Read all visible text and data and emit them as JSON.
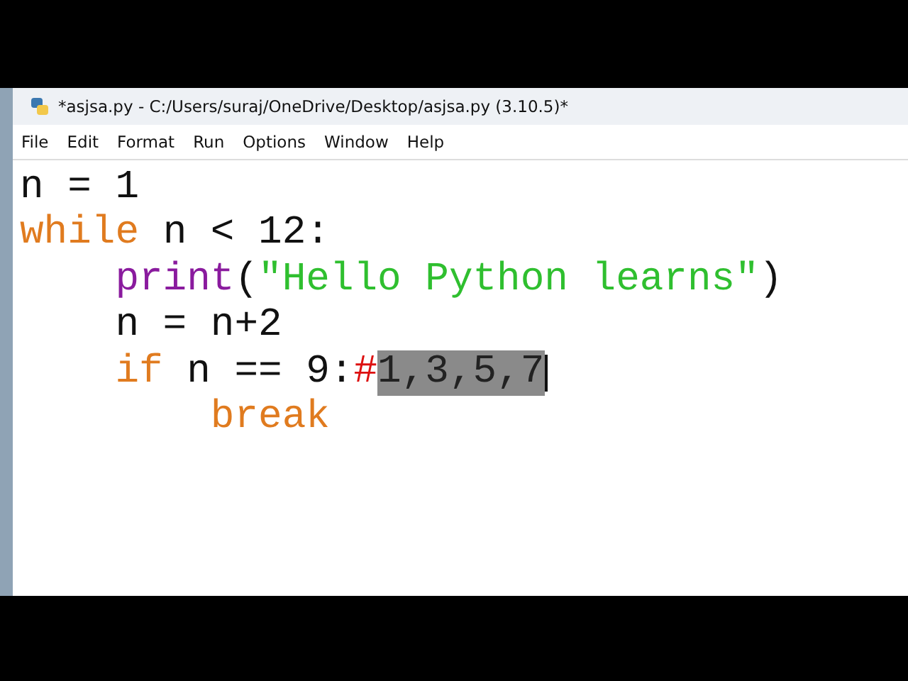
{
  "window": {
    "title": "*asjsa.py - C:/Users/suraj/OneDrive/Desktop/asjsa.py (3.10.5)*"
  },
  "menu": [
    "File",
    "Edit",
    "Format",
    "Run",
    "Options",
    "Window",
    "Help"
  ],
  "editor": {
    "lines": [
      {
        "tokens": [
          {
            "kind": "plain",
            "text": "n = 1"
          }
        ]
      },
      {
        "tokens": [
          {
            "kind": "keyword",
            "text": "while"
          },
          {
            "kind": "plain",
            "text": " n < 12:"
          }
        ],
        "children": [
          {
            "tokens": [
              {
                "kind": "builtin",
                "text": "print"
              },
              {
                "kind": "plain",
                "text": "("
              },
              {
                "kind": "string",
                "text": "\"Hello Python learns\""
              },
              {
                "kind": "plain",
                "text": ")"
              }
            ]
          },
          {
            "tokens": [
              {
                "kind": "plain",
                "text": "n = n+2"
              }
            ]
          },
          {
            "tokens": [
              {
                "kind": "keyword",
                "text": "if"
              },
              {
                "kind": "plain",
                "text": " n == 9:"
              },
              {
                "kind": "comment",
                "text": "#"
              },
              {
                "kind": "selected",
                "text": "1,3,5,7"
              }
            ],
            "caret": true,
            "children": [
              {
                "tokens": [
                  {
                    "kind": "keyword",
                    "text": "break"
                  }
                ]
              }
            ]
          }
        ]
      }
    ]
  }
}
